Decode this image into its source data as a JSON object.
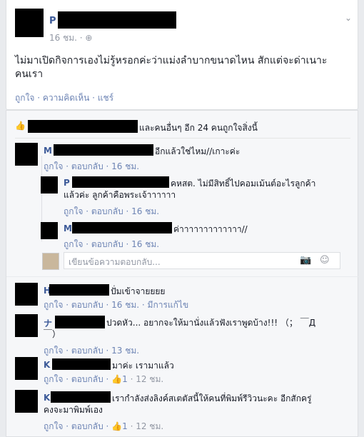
{
  "post": {
    "name_initial": "P",
    "time": "16 ชม. · ",
    "audience_icon": "globe-icon",
    "text_line1": "ไม่มาเปิดกิจการเองไม่รู้หรอกค่ะว่าแม่งลำบากขนาดไหน สักแต่จะด่าเนาะ",
    "text_line2": "คนเรา",
    "actions": "ถูกใจ · ความคิดเห็น · แชร์"
  },
  "likes": {
    "text": "และคนอื่นๆ อีก 24 คนถูกใจสิ่งนี้"
  },
  "comments": [
    {
      "initial": "M",
      "text": "อีกแล้วใช่ไหม//เกาะค่ะ",
      "actions": "ถูกใจ · ตอบกลับ · 16 ชม."
    },
    {
      "initial": "P",
      "text": "คหสต. ไม่มีสิทธิ์ไปคอมเม้นต์อะไรลูกค้า",
      "text2": "แล้วค่ะ ลูกค้าคือพระเจ้าาาาาา",
      "actions": "ถูกใจ · ตอบกลับ · 16 ชม."
    },
    {
      "initial": "M",
      "text": "ค่าาาาาาาาาาาาา//",
      "actions": "ถูกใจ · ตอบกลับ · 16 ชม."
    },
    {
      "initial": "H",
      "text": "ปั่มเข้าจายยยย",
      "actions": "ถูกใจ · ตอบกลับ · 16 ชม. · มีการแก้ไข"
    },
    {
      "initial": "ナ",
      "text": "ปวดหัว... อยากจะให้มานั่งแล้วฟังเราพูดบ้าง!!! （； ￣Д",
      "text2": "￣）",
      "actions": "ถูกใจ · ตอบกลับ · 13 ชม."
    },
    {
      "initial": "K",
      "text": "มาค่ะ เรามาแล้ว",
      "actions": "ถูกใจ · ตอบกลับ · ",
      "like_count": "1",
      "time": " · 12 ชม."
    },
    {
      "initial": "K",
      "text": "เรากำลังส่งลิงค์สเตตัสนี้ให้คนที่พิมพ์รีวิวนะคะ อีกสักครู่",
      "text2": "คงจะมาพิมพ์เอง",
      "actions": "ถูกใจ · ตอบกลับ · ",
      "like_count": "1",
      "time": " · 12 ชม."
    }
  ],
  "composer": {
    "placeholder": "เขียนข้อความตอบกลับ..."
  }
}
